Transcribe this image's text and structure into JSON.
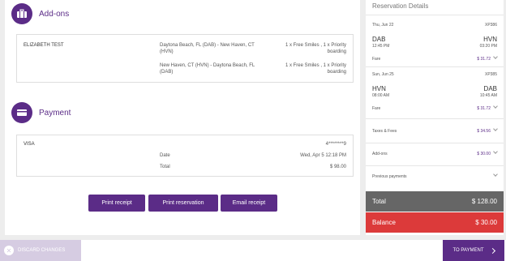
{
  "addons": {
    "title": "Add-ons",
    "passenger": "ELIZABETH TEST",
    "rows": [
      {
        "route": "Daytona Beach, FL (DAB) - New Haven, CT (HVN)",
        "items": "1 x Free Smiles , 1 x Priority boarding"
      },
      {
        "route": "New Haven, CT (HVN) - Daytona Beach, FL (DAB)",
        "items": "1 x Free Smiles , 1 x Priority boarding"
      }
    ]
  },
  "payment": {
    "title": "Payment",
    "method": "VISA",
    "card": "4********9",
    "date_label": "Date",
    "date_value": "Wed, Apr 5 12:18 PM",
    "total_label": "Total",
    "total_value": "$ 98.00"
  },
  "buttons": {
    "print_receipt": "Print receipt",
    "print_reservation": "Print reservation",
    "email_receipt": "Email receipt"
  },
  "reservation": {
    "title": "Reservation Details",
    "flights": [
      {
        "date": "Thu, Jun 22",
        "flight_no": "XP386",
        "from": "DAB",
        "dep": "12:45 PM",
        "to": "HVN",
        "arr": "03:20 PM",
        "fare_label": "Fare",
        "fare": "$ 31.72"
      },
      {
        "date": "Sun, Jun 25",
        "flight_no": "XP385",
        "from": "HVN",
        "dep": "08:00 AM",
        "to": "DAB",
        "arr": "10:45 AM",
        "fare_label": "Fare",
        "fare": "$ 31.72"
      }
    ],
    "taxes_label": "Taxes & Fees",
    "taxes": "$ 34.56",
    "addons_label": "Add-ons",
    "addons": "$ 30.00",
    "previous_label": "Previous payments",
    "total_label": "Total",
    "total": "$ 128.00",
    "balance_label": "Balance",
    "balance": "$ 30.00"
  },
  "footer": {
    "discard": "DISCARD CHANGES",
    "to_payment": "TO PAYMENT"
  },
  "colors": {
    "brand": "#5b2c87",
    "balance": "#dc3a3a",
    "total": "#666666"
  }
}
